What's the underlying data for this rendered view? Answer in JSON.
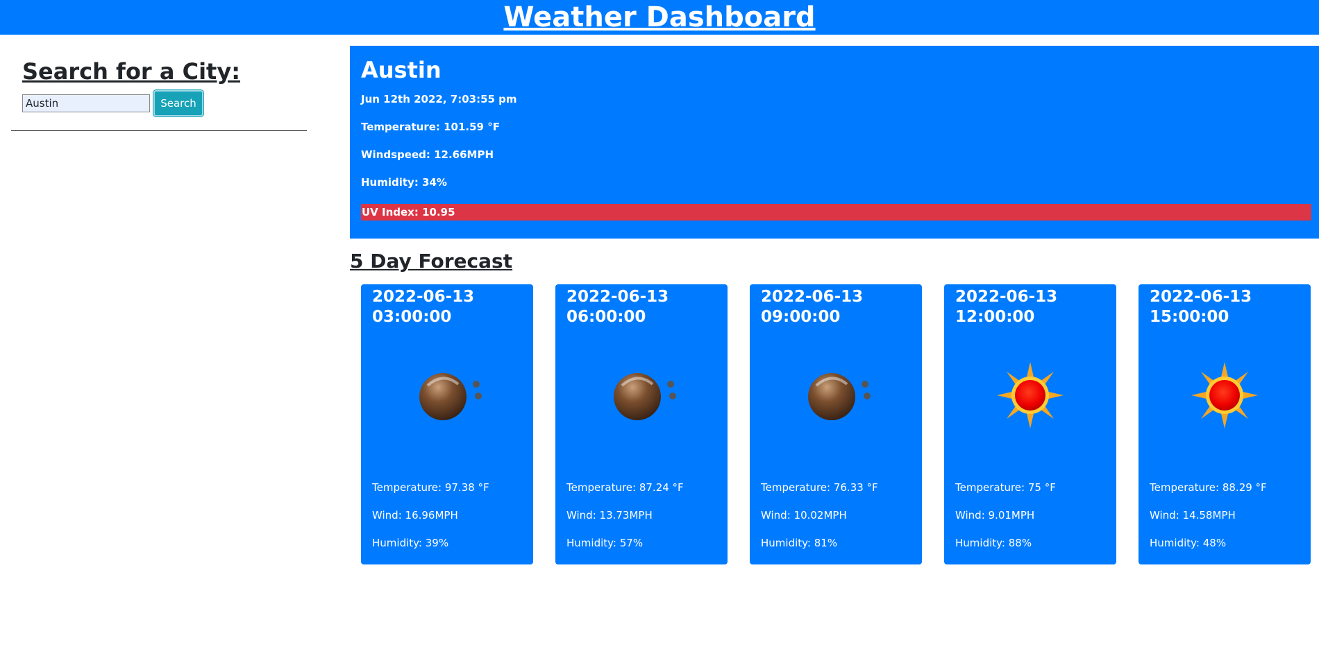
{
  "header": {
    "title": "Weather Dashboard"
  },
  "search": {
    "heading": "Search for a City:",
    "input_value": "Austin",
    "button_label": "Search"
  },
  "current": {
    "city": "Austin",
    "datetime": "Jun 12th 2022, 7:03:55 pm",
    "temperature": "Temperature: 101.59 °F",
    "windspeed": "Windspeed: 12.66MPH",
    "humidity": "Humidity: 34%",
    "uv_index": "UV Index: 10.95",
    "uv_color": "#dc3545"
  },
  "forecast": {
    "title": "5 Day Forecast",
    "cards": [
      {
        "date": "2022-06-13 03:00:00",
        "icon": "moon-icon",
        "temperature": "Temperature: 97.38 °F",
        "wind": "Wind: 16.96MPH",
        "humidity": "Humidity: 39%"
      },
      {
        "date": "2022-06-13 06:00:00",
        "icon": "moon-icon",
        "temperature": "Temperature: 87.24 °F",
        "wind": "Wind: 13.73MPH",
        "humidity": "Humidity: 57%"
      },
      {
        "date": "2022-06-13 09:00:00",
        "icon": "moon-icon",
        "temperature": "Temperature: 76.33 °F",
        "wind": "Wind: 10.02MPH",
        "humidity": "Humidity: 81%"
      },
      {
        "date": "2022-06-13 12:00:00",
        "icon": "sun-icon",
        "temperature": "Temperature: 75 °F",
        "wind": "Wind: 9.01MPH",
        "humidity": "Humidity: 88%"
      },
      {
        "date": "2022-06-13 15:00:00",
        "icon": "sun-icon",
        "temperature": "Temperature: 88.29 °F",
        "wind": "Wind: 14.58MPH",
        "humidity": "Humidity: 48%"
      }
    ]
  },
  "colors": {
    "primary": "#007bff",
    "info": "#17a2b8",
    "danger": "#dc3545"
  }
}
